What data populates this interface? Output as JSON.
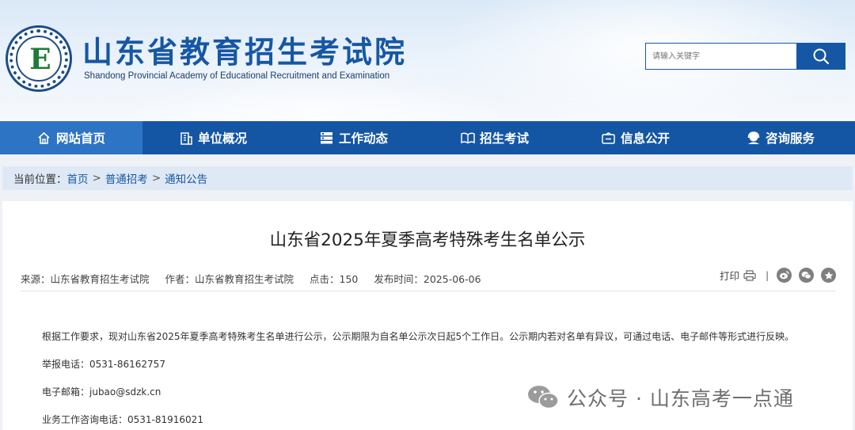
{
  "header": {
    "title": "山东省教育招生考试院",
    "subtitle": "Shandong Provincial Academy of Educational Recruitment and Examination",
    "logo_letter": "E",
    "search_placeholder": "请输入关键字"
  },
  "nav": {
    "items": [
      {
        "label": "网站首页",
        "icon": "home-icon"
      },
      {
        "label": "单位概况",
        "icon": "building-icon"
      },
      {
        "label": "工作动态",
        "icon": "list-icon"
      },
      {
        "label": "招生考试",
        "icon": "book-icon"
      },
      {
        "label": "信息公开",
        "icon": "info-box-icon"
      },
      {
        "label": "咨询服务",
        "icon": "headset-icon"
      }
    ]
  },
  "breadcrumb": {
    "prefix": "当前位置：",
    "items": [
      "首页",
      "普通招考",
      "通知公告"
    ],
    "separator": ">"
  },
  "article": {
    "title": "山东省2025年夏季高考特殊考生名单公示",
    "meta": {
      "source": "来源：山东省教育招生考试院",
      "author": "作者：山东省教育招生考试院",
      "views": "点击：150",
      "date": "发布时间：2025-06-06"
    },
    "print_label": "打印",
    "divider": "|",
    "paragraphs": [
      "根据工作要求，现对山东省2025年夏季高考特殊考生名单进行公示，公示期限为自名单公示次日起5个工作日。公示期内若对名单有异议，可通过电话、电子邮件等形式进行反映。",
      "举报电话：0531-86162757",
      "电子邮箱：jubao@sdzk.cn",
      "业务工作咨询电话：0531-81916021"
    ]
  },
  "watermark": {
    "text": "公众号 · 山东高考一点通"
  },
  "colors": {
    "brand_blue": "#1657a5",
    "nav_active": "#2e74c4",
    "breadcrumb_bg": "#dfe9f5",
    "logo_green": "#1f7a3a"
  }
}
